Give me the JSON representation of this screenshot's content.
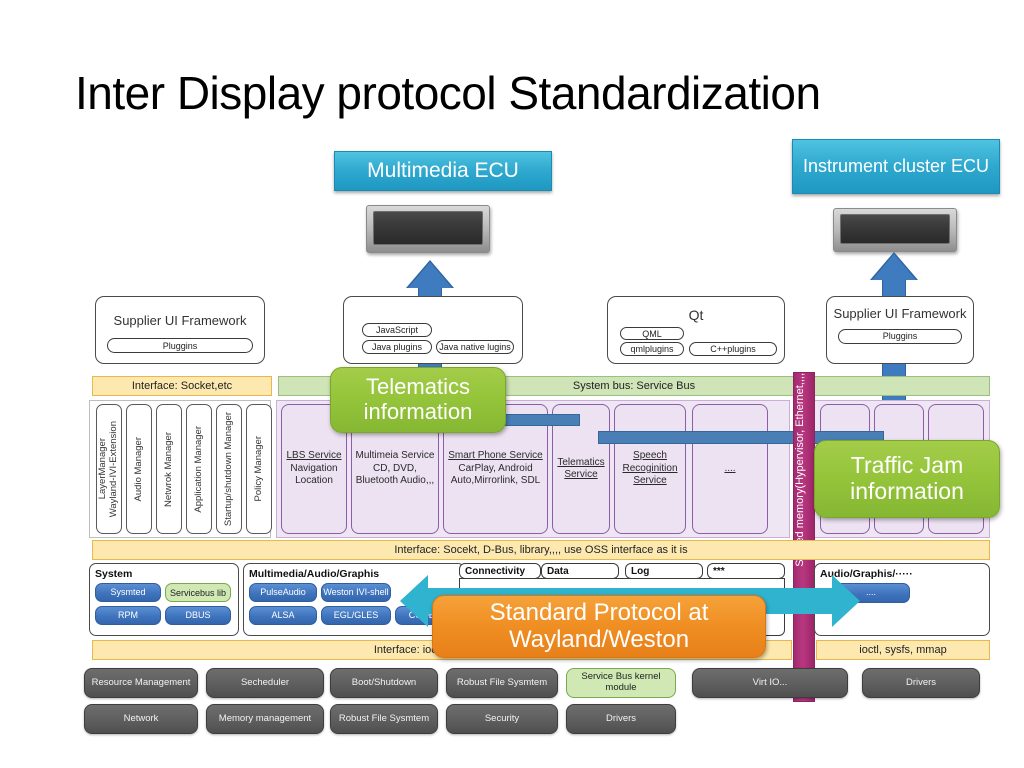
{
  "title": "Inter Display protocol Standardization",
  "ecus": {
    "multimedia": "Multimedia ECU",
    "instrument_cluster": "Instrument cluster ECU"
  },
  "displays": {
    "multimedia_display": "multimedia-display",
    "cluster_display": "cluster-display"
  },
  "frameworks": {
    "supplier_left": {
      "title": "Supplier UI Framework",
      "plugins": "Pluggins"
    },
    "java_box": {
      "javascript": "JavaScript",
      "java_plugins": "Java plugins",
      "java_native": "Java native lugins"
    },
    "qt": {
      "title": "Qt",
      "qml": "QML",
      "qmlplugins": "qmlplugins",
      "cppplugins": "C++plugins"
    },
    "supplier_right": {
      "title": "Supplier UI Framework",
      "plugins": "Pluggins"
    }
  },
  "bars": {
    "interface_socket": "Interface: Socket,etc",
    "system_bus": "System bus: Service Bus",
    "interface_middle": "Interface: Socekt, D-Bus, library,,,, use OSS interface as it is",
    "interface_ioctl_left": "Interface: ioctl, sysfs, mmap",
    "interface_ioctl_right": "ioctl, sysfs, mmap"
  },
  "managers": [
    "LayerManager\nWayland-IVI-Extension",
    "Audio Manager",
    "Netwrok Manager",
    "Application Manager",
    "Startup/shutdown Manager",
    "Policy Manager"
  ],
  "services": [
    {
      "name": "LBS Service",
      "detail": "Navigation\nLocation"
    },
    {
      "name": "Multimeia Service",
      "detail": "CD, DVD,\nBluetooth Audio,,,"
    },
    {
      "name": "Smart Phone Service",
      "detail": "CarPlay, Android\nAuto,Mirrorlink, SDL"
    },
    {
      "name": "Telematics Service",
      "detail": ""
    },
    {
      "name": "Speech Recoginition Service",
      "detail": ""
    },
    {
      "name": "....",
      "detail": ""
    }
  ],
  "shared_memory_bar": "Shared memory(Hypervisor, Ethernet,,,,",
  "middleware": {
    "system": {
      "title": "System",
      "chips": [
        "Sysmted",
        "Servicebus lib",
        "RPM",
        "DBUS"
      ],
      "green_chip": "Servicebus lib"
    },
    "mm_audio_graphics": {
      "title": "Multimedia/Audio/Graphis",
      "chips": [
        "PulseAudio",
        "Weston IVI-shell",
        "ALSA",
        "EGL/GLES",
        "CODEC"
      ]
    },
    "tabs": [
      "Connectivity",
      "Data",
      "Log",
      "***"
    ],
    "right_group": {
      "title": "Audio/Graphis/·····",
      "chip": "...."
    }
  },
  "kernel": {
    "row1": [
      "Resource Management",
      "Secheduler",
      "Boot/Shutdown",
      "Robust File Sysmtem",
      "Service Bus kernel module",
      "Virt IO...",
      "Drivers"
    ],
    "row2": [
      "Network",
      "Memory management",
      "Robust File Sysmtem",
      "Security",
      "Drivers"
    ],
    "green_module": "Service Bus kernel module"
  },
  "callouts": {
    "telematics": "Telematics information",
    "traffic_jam": "Traffic Jam information",
    "standard_protocol": "Standard Protocol at Wayland/Weston"
  },
  "colors": {
    "ecu_blue": "#2fa9cf",
    "arrow_blue": "#3f7cbf",
    "teal_arrow": "#2fb3cf",
    "callout_green": "#94c43a",
    "callout_orange": "#ef8e22",
    "shared_purple": "#b83780",
    "bar_yellow": "#fde9b0",
    "bar_green": "#cfe5b8",
    "service_purple": "#ece2f2",
    "kernel_gray": "#5e5e5e"
  }
}
